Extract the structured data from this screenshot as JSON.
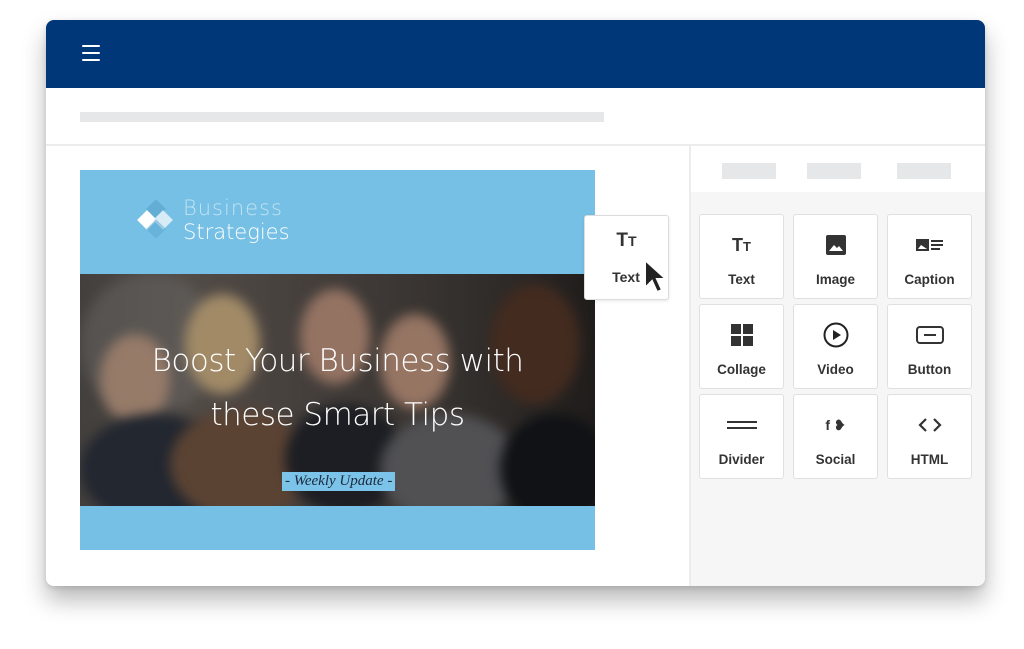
{
  "header": {
    "menu_icon": "hamburger-icon",
    "background": "#003778"
  },
  "email": {
    "brand_line1": "Business",
    "brand_line2": "Strategies",
    "hero_title_line1": "Boost Your Business with",
    "hero_title_line2": "these Smart Tips",
    "badge": "- Weekly Update -",
    "accent": "#77c0e5"
  },
  "dragging_block": {
    "icon": "text-size-icon",
    "glyph": "Tт",
    "label": "Text"
  },
  "panel": {
    "tabs": [
      "",
      "",
      ""
    ],
    "blocks": [
      {
        "label": "Text",
        "icon": "text-size-icon"
      },
      {
        "label": "Image",
        "icon": "image-icon"
      },
      {
        "label": "Caption",
        "icon": "caption-icon"
      },
      {
        "label": "Collage",
        "icon": "collage-icon"
      },
      {
        "label": "Video",
        "icon": "video-play-icon"
      },
      {
        "label": "Button",
        "icon": "button-icon"
      },
      {
        "label": "Divider",
        "icon": "divider-icon"
      },
      {
        "label": "Social",
        "icon": "social-icon"
      },
      {
        "label": "HTML",
        "icon": "code-icon"
      }
    ]
  }
}
